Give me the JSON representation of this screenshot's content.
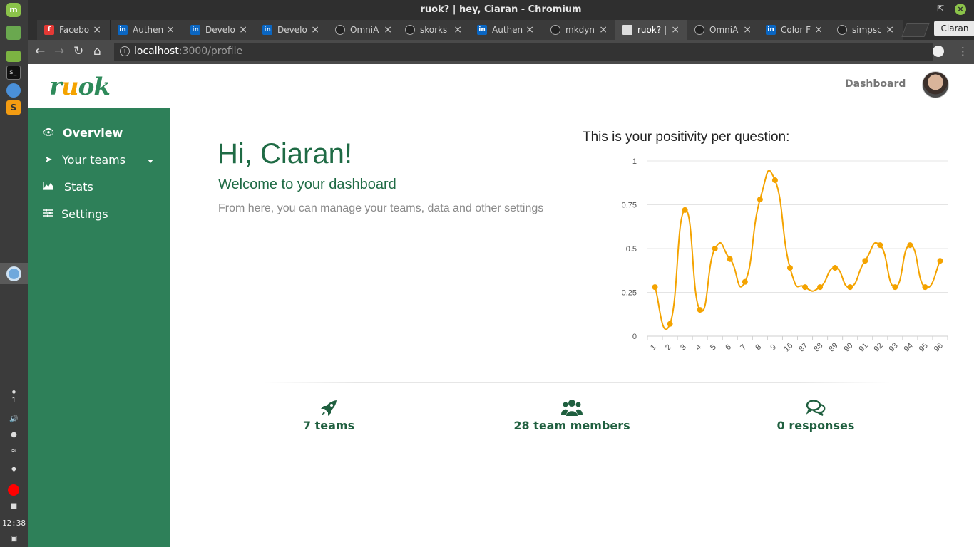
{
  "os": {
    "tray_alert_count": "1",
    "clock": "12:38"
  },
  "browser": {
    "window_title": "ruok? | hey, Ciaran - Chromium",
    "profile": "Ciaran",
    "tabs": [
      {
        "label": "Facebo",
        "favicon": "facebook-icon"
      },
      {
        "label": "Authen",
        "favicon": "linkedin-icon"
      },
      {
        "label": "Develo",
        "favicon": "linkedin-icon"
      },
      {
        "label": "Develo",
        "favicon": "linkedin-icon"
      },
      {
        "label": "OmniA",
        "favicon": "github-icon"
      },
      {
        "label": "skorks",
        "favicon": "github-icon"
      },
      {
        "label": "Authen",
        "favicon": "linkedin-icon"
      },
      {
        "label": "mkdyn",
        "favicon": "github-icon"
      },
      {
        "label": "ruok? |",
        "favicon": "document-icon",
        "active": true
      },
      {
        "label": "OmniA",
        "favicon": "github-icon"
      },
      {
        "label": "Color F",
        "favicon": "linkedin-icon"
      },
      {
        "label": "simpsc",
        "favicon": "github-icon"
      }
    ],
    "url_host": "localhost",
    "url_rest": ":3000/profile"
  },
  "app": {
    "logo_prefix": "r",
    "logo_u": "u",
    "logo_suffix": "ok",
    "header_link": "Dashboard",
    "accent": "#2e8059",
    "brand_orange": "#f4a300",
    "sidebar": [
      {
        "label": "Overview",
        "icon": "eye-icon"
      },
      {
        "label": "Your teams",
        "icon": "rocket-icon"
      },
      {
        "label": "Stats",
        "icon": "area-chart-icon"
      },
      {
        "label": "Settings",
        "icon": "sliders-icon"
      }
    ],
    "greeting": "Hi, Ciaran!",
    "welcome": "Welcome to your dashboard",
    "intro": "From here, you can manage your teams, data and other settings",
    "chart_title": "This is your positivity per question:",
    "stats": [
      {
        "label": "7 teams",
        "icon": "rocket-icon"
      },
      {
        "label": "28 team members",
        "icon": "users-icon"
      },
      {
        "label": "0 responses",
        "icon": "comments-icon"
      }
    ]
  },
  "chart_data": {
    "type": "line",
    "smooth": true,
    "color": "#f4a300",
    "title": "This is your positivity per question:",
    "categories": [
      "1",
      "2",
      "3",
      "4",
      "5",
      "6",
      "7",
      "8",
      "9",
      "16",
      "87",
      "88",
      "89",
      "90",
      "91",
      "92",
      "93",
      "94",
      "95",
      "96"
    ],
    "values": [
      0.28,
      0.07,
      0.72,
      0.15,
      0.5,
      0.44,
      0.31,
      0.78,
      0.89,
      0.39,
      0.28,
      0.28,
      0.39,
      0.28,
      0.43,
      0.52,
      0.28,
      0.52,
      0.28,
      0.43
    ],
    "ylim": [
      0,
      1
    ],
    "yticks": [
      "0",
      "0.25",
      "0.5",
      "0.75",
      "1"
    ],
    "grid": true
  }
}
